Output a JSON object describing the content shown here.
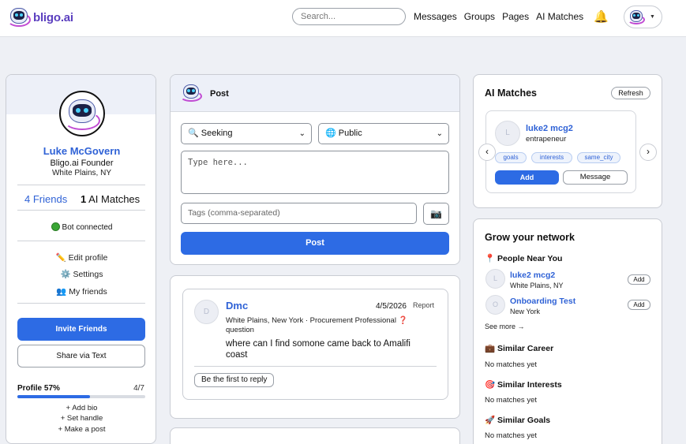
{
  "nav": {
    "logo_text": "bligo.ai",
    "search_placeholder": "Search...",
    "links": [
      "Messages",
      "Groups",
      "Pages",
      "AI Matches"
    ],
    "bell_icon": "bell-icon"
  },
  "profile": {
    "name": "Luke McGovern",
    "title": "Bligo.ai Founder",
    "location": "White Plains, NY",
    "friends_count": "4",
    "friends_label": "Friends",
    "ai_matches_count": "1",
    "ai_matches_label": "AI Matches",
    "bot_status": "Bot connected",
    "links": [
      "✏️ Edit profile",
      "⚙️ Settings",
      "👥 My friends"
    ],
    "invite_label": "Invite Friends",
    "share_label": "Share via Text",
    "progress_label": "Profile 57%",
    "progress_count": "4/7",
    "progress_value": 0.57,
    "todos": [
      "+ Add bio",
      "+ Set handle",
      "+ Make a post"
    ]
  },
  "composer": {
    "title": "Post",
    "seeking": "🔍 Seeking",
    "visibility": "🌐 Public",
    "textarea_placeholder": "Type here...",
    "tags_placeholder": "Tags (comma-separated)",
    "camera_icon": "📷",
    "submit_label": "Post"
  },
  "feed": [
    {
      "avatar_initial": "D",
      "author": "Dmc",
      "date": "4/5/2026",
      "report": "Report",
      "meta": "White Plains, New York · Procurement Professional",
      "meta_tail": "question",
      "question_mark": "❓",
      "body": "where can I find somone came back to Amalifi coast",
      "reply_label": "Be the first to reply"
    }
  ],
  "ai_matches": {
    "title": "AI Matches",
    "refresh_label": "Refresh",
    "prev": "‹",
    "next": "›",
    "match": {
      "avatar_initial": "L",
      "name": "luke2 mcg2",
      "role": "entrapeneur",
      "tags": [
        "goals",
        "interests",
        "same_city"
      ],
      "add_label": "Add",
      "message_label": "Message"
    }
  },
  "grow": {
    "title": "Grow your network",
    "near_label": "📍 People Near You",
    "people": [
      {
        "initial": "L",
        "name": "luke2 mcg2",
        "location": "White Plains, NY",
        "add": "Add"
      },
      {
        "initial": "O",
        "name": "Onboarding Test",
        "location": "New York",
        "add": "Add"
      }
    ],
    "see_more": "See more →",
    "sections": [
      {
        "label": "💼 Similar Career",
        "empty": "No matches yet"
      },
      {
        "label": "🎯 Similar Interests",
        "empty": "No matches yet"
      },
      {
        "label": "🚀 Similar Goals",
        "empty": "No matches yet"
      }
    ]
  }
}
